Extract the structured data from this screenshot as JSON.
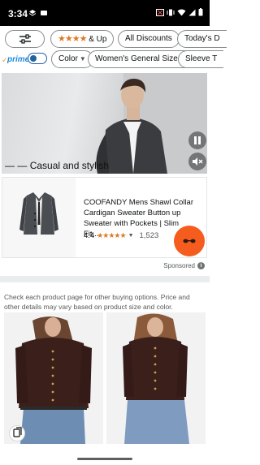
{
  "status_bar": {
    "time": "3:34"
  },
  "filters": {
    "row1": [
      {
        "id": "filter-settings",
        "label": ""
      },
      {
        "id": "rating",
        "stars": "★★★★",
        "label": "& Up"
      },
      {
        "id": "all-discounts",
        "label": "All Discounts"
      },
      {
        "id": "todays-deals",
        "label": "Today's D"
      }
    ],
    "prime_label": "prime",
    "row2": [
      {
        "id": "color",
        "label": "Color"
      },
      {
        "id": "womens-size",
        "label": "Women's General Size"
      },
      {
        "id": "sleeve",
        "label": "Sleeve T"
      }
    ]
  },
  "video": {
    "caption": "Casual and stylish"
  },
  "sponsored_product": {
    "title": "COOFANDY Mens Shawl Collar Cardigan Sweater Button up Sweater with Pockets | Slim Fit,...",
    "rating_value": "4.4",
    "rating_stars": "★★★★★",
    "rating_fraction": 0.88,
    "review_count": "1,523"
  },
  "sponsored_label": "Sponsored",
  "notice": "Check each product page for other buying options. Price and other details may vary based on product size and color.",
  "colors": {
    "accent_orange": "#f55c1e",
    "star_orange": "#de7921",
    "prime_blue": "#1f8adf",
    "toggle_blue": "#2162a1",
    "sweater_brown": "#3b1f1b"
  }
}
